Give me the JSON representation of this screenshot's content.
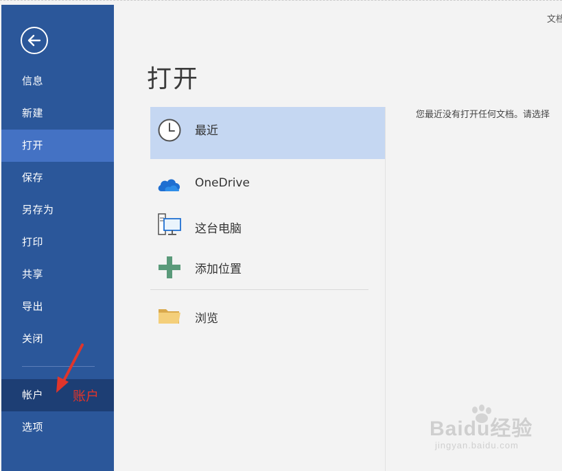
{
  "header": {
    "right_text": "文档"
  },
  "sidebar": {
    "back_icon": "back-arrow-icon",
    "items": [
      {
        "label": "信息"
      },
      {
        "label": "新建"
      },
      {
        "label": "打开",
        "active": true
      },
      {
        "label": "保存"
      },
      {
        "label": "另存为"
      },
      {
        "label": "打印"
      },
      {
        "label": "共享"
      },
      {
        "label": "导出"
      },
      {
        "label": "关闭"
      },
      {
        "label": "帐户"
      },
      {
        "label": "选项"
      }
    ]
  },
  "annotation": {
    "label": "账户",
    "color": "#e0352b"
  },
  "main": {
    "title": "打开",
    "empty_message": "您最近没有打开任何文档。请选择",
    "locations": [
      {
        "label": "最近",
        "icon": "clock-icon",
        "selected": true
      },
      {
        "label": "OneDrive",
        "icon": "cloud-icon"
      },
      {
        "label": "这台电脑",
        "icon": "computer-icon"
      },
      {
        "label": "添加位置",
        "icon": "plus-icon"
      },
      {
        "label": "浏览",
        "icon": "folder-icon"
      }
    ]
  },
  "watermark": {
    "main": "Baidu经验",
    "sub": "jingyan.baidu.com"
  },
  "colors": {
    "sidebar": "#2b579a",
    "sidebar_active": "#4472c4",
    "selected_location": "#c5d7f2",
    "annotation": "#e0352b"
  }
}
